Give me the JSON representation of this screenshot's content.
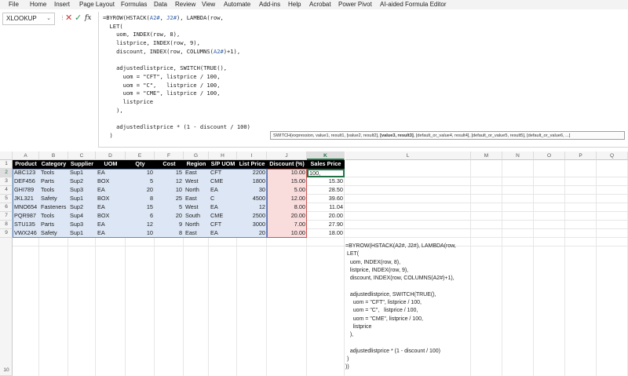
{
  "menu": [
    "File",
    "Home",
    "Insert",
    "Page Layout",
    "Formulas",
    "Data",
    "Review",
    "View",
    "Automate",
    "Add-ins",
    "Help",
    "Acrobat",
    "Power Pivot",
    "AI-aided Formula Editor"
  ],
  "name_box": "XLOOKUP",
  "formula_icons": {
    "cancel": "✕",
    "confirm": "✓",
    "fx": "fx"
  },
  "formula_lines": [
    "=BYROW(HSTACK(A2#, J2#), LAMBDA(row,",
    "  LET(",
    "    uom, INDEX(row, 8),",
    "    listprice, INDEX(row, 9),",
    "    discount, INDEX(row, COLUMNS(A2#)+1),",
    "",
    "    adjustedlistprice, SWITCH(TRUE(),",
    "      uom = \"CFT\", listprice / 100,",
    "      uom = \"C\",   listprice / 100,",
    "      uom = \"CME\", listprice / 100,",
    "      listprice",
    "    ),",
    "",
    "    adjustedlistprice * (1 - discount / 100)",
    "  )"
  ],
  "tooltip": {
    "before": "SWITCH(expression, value1, result1, [value2, result2], ",
    "bold": "[value3, result3]",
    "after": ", [default_or_value4, result4], [default_or_value5, result5], [default_or_value6, ...]"
  },
  "columns": [
    "A",
    "B",
    "C",
    "D",
    "E",
    "F",
    "G",
    "H",
    "I",
    "J",
    "K",
    "L",
    "M",
    "N",
    "O",
    "P",
    "Q"
  ],
  "rows": [
    "1",
    "2",
    "3",
    "4",
    "5",
    "6",
    "7",
    "8",
    "9",
    "10"
  ],
  "headers": [
    "Product",
    "Category",
    "Supplier",
    "UOM",
    "Qty",
    "Cost",
    "Region",
    "S/P UOM",
    "List Price",
    "Discount (%)",
    "Sales Price"
  ],
  "data": [
    [
      "ABC123",
      "Tools",
      "Sup1",
      "EA",
      "10",
      "15",
      "East",
      "CFT",
      "2200",
      "10.00",
      ""
    ],
    [
      "DEF456",
      "Parts",
      "Sup2",
      "BOX",
      "5",
      "12",
      "West",
      "CME",
      "1800",
      "15.00",
      "15.30"
    ],
    [
      "GHI789",
      "Tools",
      "Sup3",
      "EA",
      "20",
      "10",
      "North",
      "EA",
      "30",
      "5.00",
      "28.50"
    ],
    [
      "JKL321",
      "Safety",
      "Sup1",
      "BOX",
      "8",
      "25",
      "East",
      "C",
      "4500",
      "12.00",
      "39.60"
    ],
    [
      "MNO654",
      "Fasteners",
      "Sup2",
      "EA",
      "15",
      "5",
      "West",
      "EA",
      "12",
      "8.00",
      "11.04"
    ],
    [
      "PQR987",
      "Tools",
      "Sup4",
      "BOX",
      "6",
      "20",
      "South",
      "CME",
      "2500",
      "20.00",
      "20.00"
    ],
    [
      "STU135",
      "Parts",
      "Sup3",
      "EA",
      "12",
      "9",
      "North",
      "CFT",
      "3000",
      "7.00",
      "27.90"
    ],
    [
      "VWX246",
      "Safety",
      "Sup1",
      "EA",
      "10",
      "8",
      "East",
      "EA",
      "20",
      "10.00",
      "18.00"
    ]
  ],
  "k2_edit": "100,",
  "notes_lines": [
    "=BYROW(HSTACK(A2#, J2#), LAMBDA(row,",
    " LET(",
    "   uom, INDEX(row, 8),",
    "   listprice, INDEX(row, 9),",
    "   discount, INDEX(row, COLUMNS(A2#)+1),",
    "",
    "   adjustedlistprice, SWITCH(TRUE(),",
    "     uom = \"CFT\", listprice / 100,",
    "     uom = \"C\",   listprice / 100,",
    "     uom = \"CME\", listprice / 100,",
    "     listprice",
    "   ),",
    "",
    "   adjustedlistprice * (1 - discount / 100)",
    " )",
    "))"
  ]
}
